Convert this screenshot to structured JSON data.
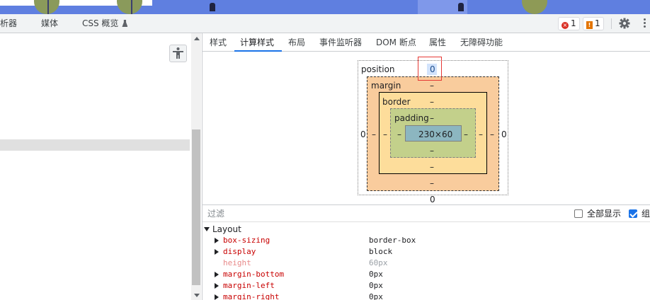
{
  "top_tabs": {
    "partial_analyzer": "析器",
    "media": "媒体",
    "css_overview": "CSS 概览"
  },
  "status": {
    "errors": "1",
    "warnings": "1"
  },
  "sub_tabs": [
    "样式",
    "计算样式",
    "布局",
    "事件监听器",
    "DOM 断点",
    "属性",
    "无障碍功能"
  ],
  "box_model": {
    "position_label": "position",
    "position_top": "0",
    "position_left": "0",
    "position_right": "0",
    "position_bottom": "0",
    "margin_label": "margin",
    "border_label": "border",
    "padding_label": "padding",
    "dash": "–",
    "content_size": "230×60"
  },
  "filter": {
    "placeholder": "过滤",
    "show_all": "全部显示",
    "group": "组"
  },
  "computed": {
    "group_name": "Layout",
    "properties": [
      {
        "name": "box-sizing",
        "value": "border-box",
        "inherited": false,
        "color": "#c80000"
      },
      {
        "name": "display",
        "value": "block",
        "inherited": false,
        "color": "#c80000"
      },
      {
        "name": "height",
        "value": "60px",
        "inherited": true,
        "color": "#e88a8a"
      },
      {
        "name": "margin-bottom",
        "value": "0px",
        "inherited": false,
        "color": "#c80000"
      },
      {
        "name": "margin-left",
        "value": "0px",
        "inherited": false,
        "color": "#c80000"
      },
      {
        "name": "margin-right",
        "value": "0px",
        "inherited": false,
        "color": "#c80000"
      }
    ]
  },
  "colors": {
    "accent": "#1a73e8",
    "margin_fill": "#f9cc9d",
    "border_fill": "#fddd9b",
    "padding_fill": "#c3d08b",
    "content_fill": "#8cb6c0",
    "error": "#d93025",
    "warning": "#e37400"
  },
  "icons": [
    "accessibility-icon",
    "gear-icon",
    "more-vertical-icon",
    "error-icon",
    "warning-icon",
    "flask-icon"
  ]
}
